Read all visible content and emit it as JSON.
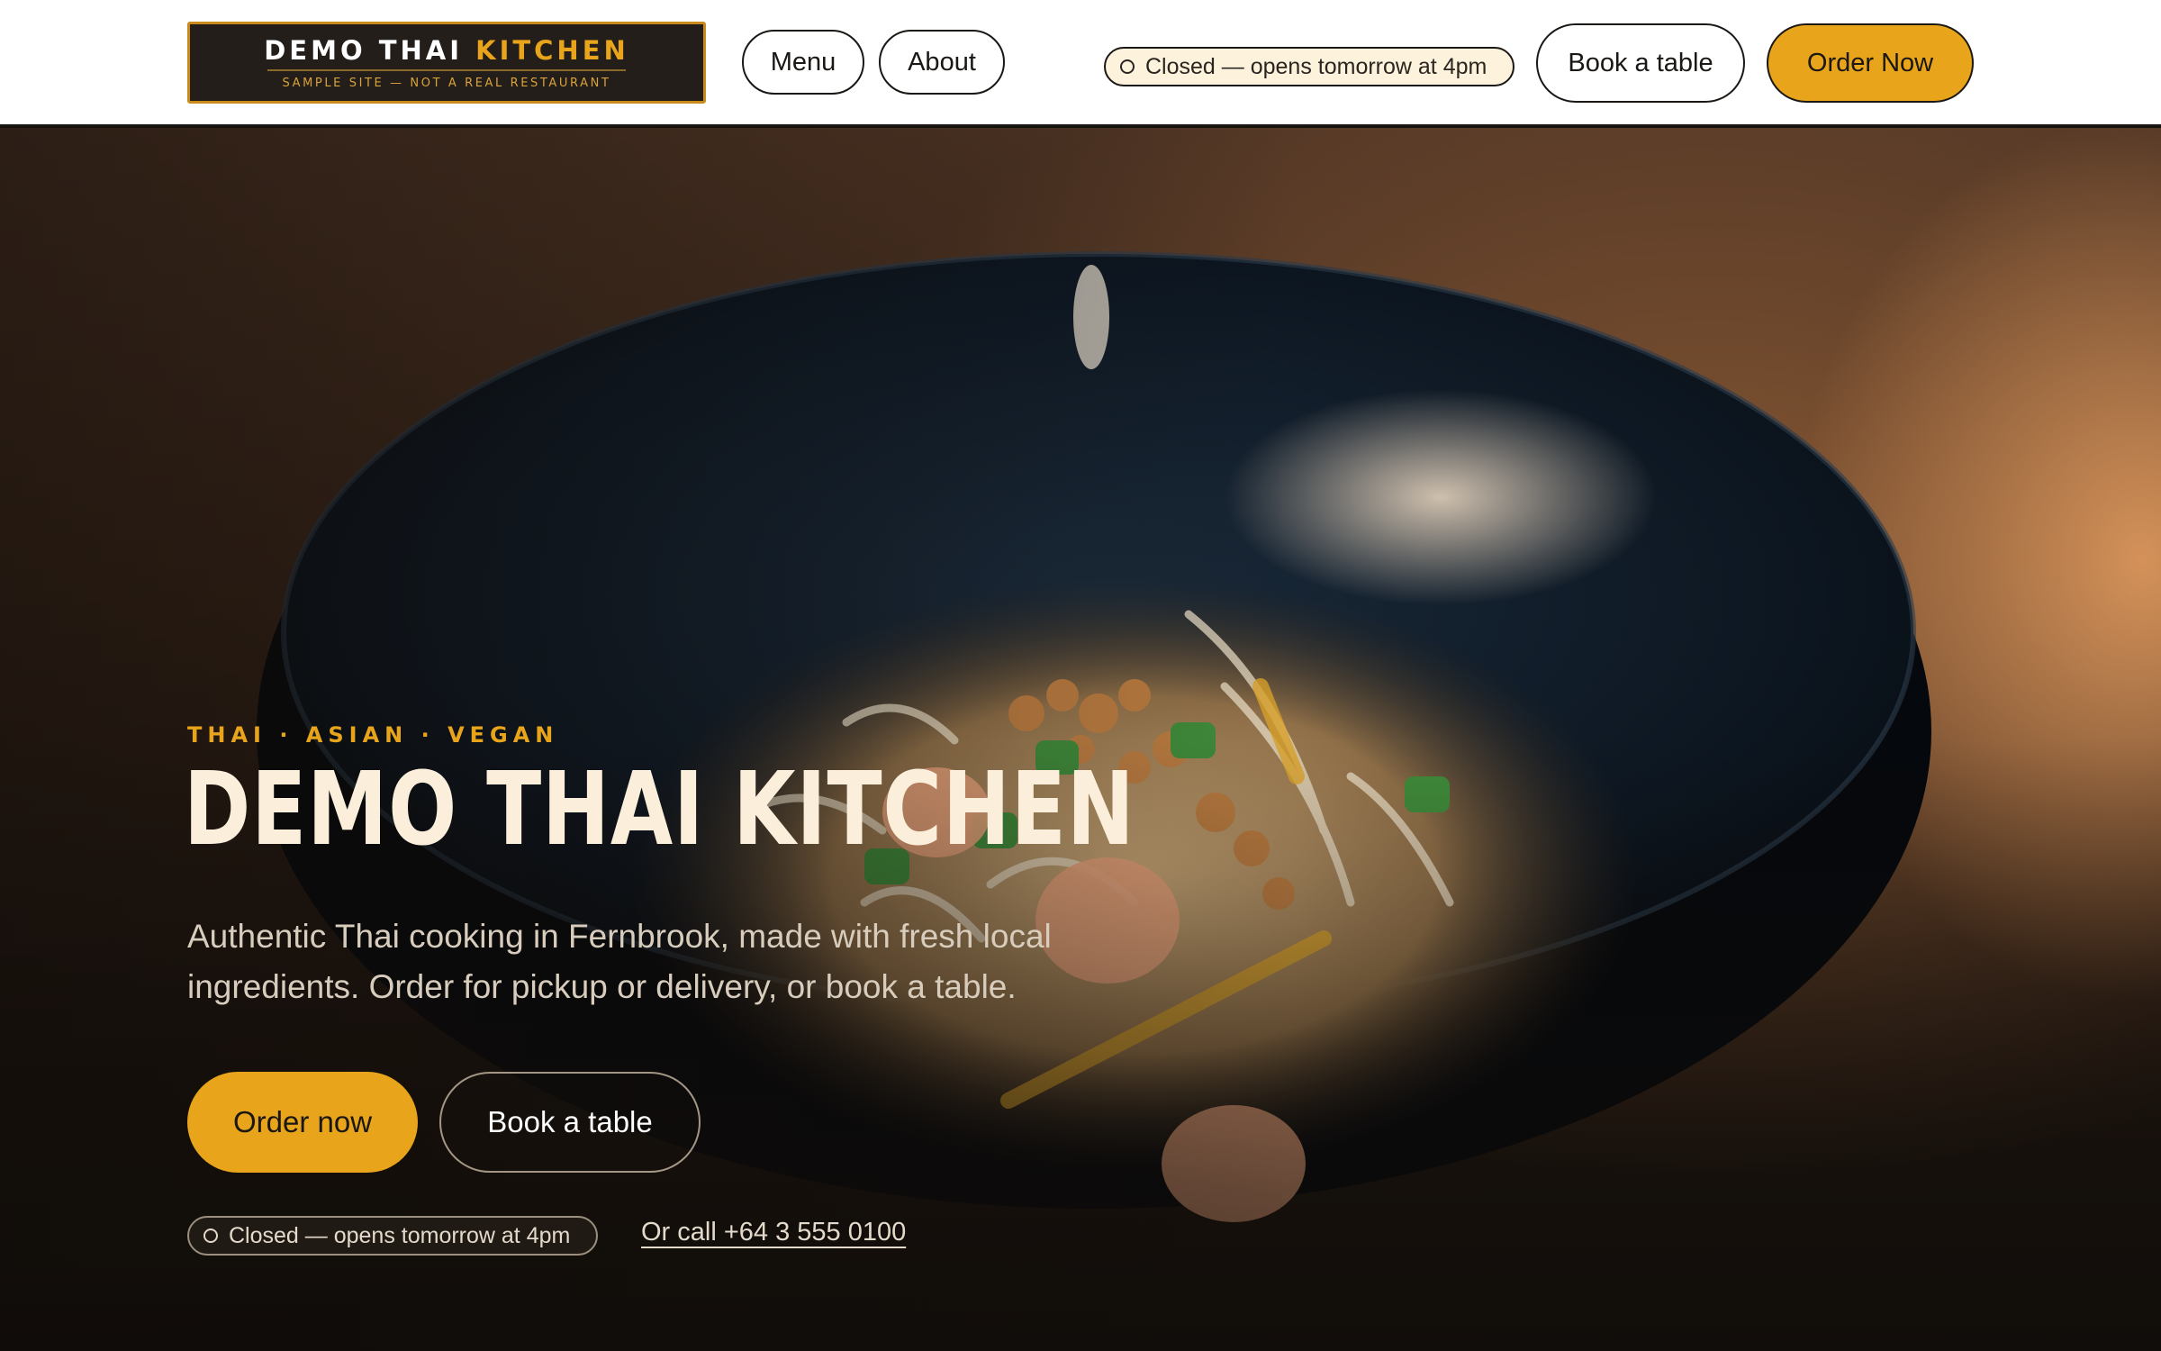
{
  "header": {
    "logo": {
      "title_main": "DEMO THAI",
      "title_accent": "KITCHEN",
      "subtitle": "SAMPLE SITE — NOT A REAL RESTAURANT"
    },
    "nav": [
      {
        "label": "Menu"
      },
      {
        "label": "About"
      }
    ],
    "status": "Closed — opens tomorrow at 4pm",
    "book_label": "Book a table",
    "order_label": "Order Now"
  },
  "hero": {
    "eyebrow": "THAI · ASIAN · VEGAN",
    "title": "DEMO THAI KITCHEN",
    "description": "Authentic Thai cooking in Fernbrook, made with fresh local ingredients. Order for pickup or delivery, or book a table.",
    "order_label": "Order now",
    "book_label": "Book a table",
    "status": "Closed — opens tomorrow at 4pm",
    "call_label": "Or call +64 3 555 0100",
    "photo_subject": "pad-thai-bowl-photo"
  },
  "colors": {
    "accent": "#e8a41a",
    "dark": "#1a1714",
    "cream": "#fbefdc"
  }
}
